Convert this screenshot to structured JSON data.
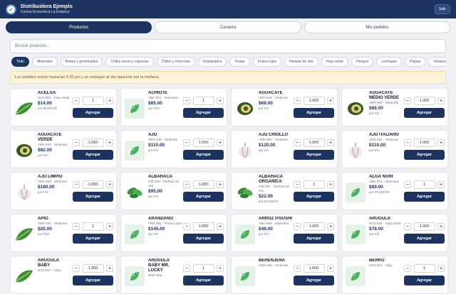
{
  "header": {
    "title": "Distribuidora Ejemplo",
    "subtitle": "Cocina Economica La Esquina",
    "logout": "Salir"
  },
  "tabs": [
    "Productos",
    "Canasta",
    "Mis pedidos"
  ],
  "search": {
    "placeholder": "Buscar producto..."
  },
  "chips": [
    "Todo",
    "Abarrotes",
    "Brotes y germinados",
    "Chiles secos y especias",
    "Chiles y morrones",
    "Empacados",
    "Frutas",
    "Frutos rojos",
    "Hierbas de olor",
    "Hoja verde",
    "Hongos",
    "Lechugas",
    "Pulpas",
    "Verduras"
  ],
  "notice": "Los pedidos entran hasta las 5:00 pm y se entregan al día siguiente por la mañana.",
  "add_label": "Agregar",
  "products": [
    {
      "name": "ACELGA",
      "code": "HOJ-003 · Hoja verde",
      "price": "$14.00",
      "unit": "por MANOJO",
      "qty": "1",
      "icon": "leaf-icon"
    },
    {
      "name": "ACHIOTE",
      "code": "ABA-001 · Abarrotes",
      "price": "$85.00",
      "unit": "por PZA",
      "qty": "1",
      "icon": "placeholder-icon"
    },
    {
      "name": "AGUACATE",
      "code": "VER-046 · Verduras",
      "price": "$68.00",
      "unit": "por KG",
      "qty": "1.000",
      "icon": "avocado-icon"
    },
    {
      "name": "AGUACATE MEDIO VERDE",
      "code": "VER-047 · Verduras",
      "price": "$68.00",
      "unit": "por KG",
      "qty": "1.000",
      "icon": "avocado-icon"
    },
    {
      "name": "AGUACATE VERDE",
      "code": "VER-048 · Verduras",
      "price": "$82.00",
      "unit": "por KG",
      "qty": "1.000",
      "icon": "avocado-icon"
    },
    {
      "name": "AJO",
      "code": "VER-049 · Verduras",
      "price": "$110.00",
      "unit": "por KG",
      "qty": "1.000",
      "icon": "placeholder-icon"
    },
    {
      "name": "AJO CRIOLLO",
      "code": "VER-050 · Verduras",
      "price": "$120.00",
      "unit": "por KG",
      "qty": "1.000",
      "icon": "garlic-icon"
    },
    {
      "name": "AJO ITALIANO",
      "code": "VER-051 · Verduras",
      "price": "$110.00",
      "unit": "por KG",
      "qty": "1.000",
      "icon": "garlic-icon"
    },
    {
      "name": "AJO LIMPIO",
      "code": "VER-039 · Verduras",
      "price": "$180.00",
      "unit": "por KG",
      "qty": "1.000",
      "icon": "garlic-icon"
    },
    {
      "name": "ALBAHACA",
      "code": "HIE-006 · Hierbas de olor",
      "price": "$95.00",
      "unit": "por KG",
      "qty": "1.000",
      "icon": "herb-icon"
    },
    {
      "name": "ALBAHACA ORGANICA",
      "code": "HIE-007 · Hierbas de olor",
      "price": "$22.00",
      "unit": "por MANOJO",
      "qty": "1",
      "icon": "herb-icon"
    },
    {
      "name": "ALGA NORI",
      "code": "ABA-003 · Abarrotes",
      "price": "$89.00",
      "unit": "por PAQUETE",
      "qty": "1",
      "icon": "placeholder-icon"
    },
    {
      "name": "APIO",
      "code": "VER-032 · Verduras",
      "price": "$25.00",
      "unit": "por PZA",
      "qty": "1",
      "icon": "leaf-icon"
    },
    {
      "name": "ARANDANO",
      "code": "FRR-001 · Frutos rojos",
      "price": "$145.00",
      "unit": "por KG",
      "qty": "1.000",
      "icon": "placeholder-icon"
    },
    {
      "name": "ARROZ P/SUSHI",
      "code": "ABA-005 · Abarrotes",
      "price": "$48.00",
      "unit": "por KG",
      "qty": "1.000",
      "icon": "placeholder-icon"
    },
    {
      "name": "ARUGULA",
      "code": "HOJ-006 · Hoja verde",
      "price": "$78.00",
      "unit": "por KG",
      "qty": "1.000",
      "icon": "placeholder-icon"
    },
    {
      "name": "ARUGULA BABY",
      "code": "HOJ-007 · Hoja",
      "price": "",
      "unit": "",
      "qty": "1.000",
      "icon": "leaf-icon"
    },
    {
      "name": "ARUGULA BABY MR. LUCKY",
      "code": "EMP-002",
      "price": "",
      "unit": "",
      "qty": "1",
      "icon": "placeholder-icon"
    },
    {
      "name": "BERENJENA",
      "code": "VER-035 · Verduras",
      "price": "",
      "unit": "",
      "qty": "1.000",
      "icon": "placeholder-icon"
    },
    {
      "name": "BERRO",
      "code": "HOJ-014 · Hoja",
      "price": "",
      "unit": "",
      "qty": "1",
      "icon": "placeholder-icon"
    }
  ],
  "colors": {
    "primary": "#1d3461",
    "notice_bg": "#fdf3d8"
  }
}
